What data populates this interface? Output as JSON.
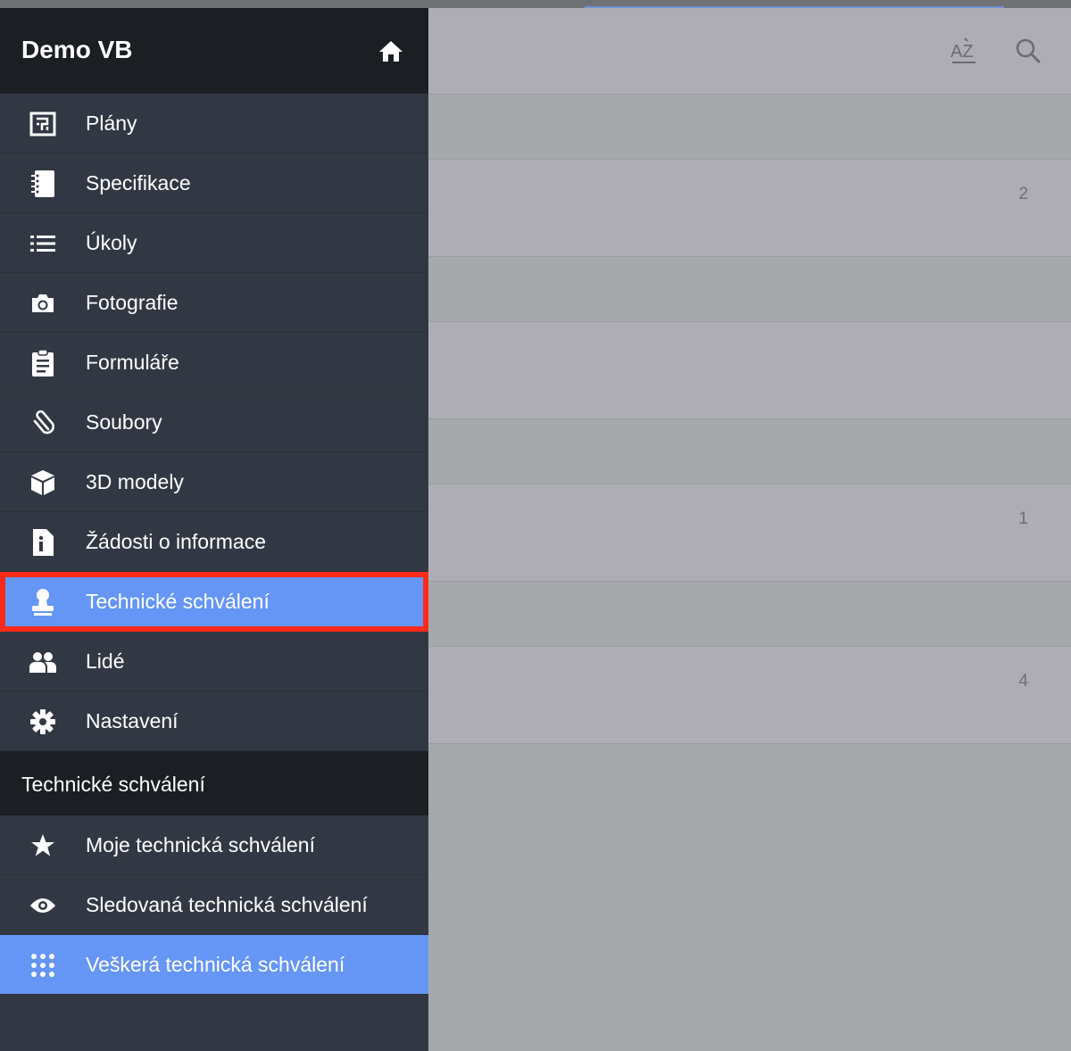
{
  "app": {
    "title": "Demo VB"
  },
  "nav": {
    "items": [
      {
        "label": "Plány",
        "icon": "floorplan-icon"
      },
      {
        "label": "Specifikace",
        "icon": "notebook-icon"
      },
      {
        "label": "Úkoly",
        "icon": "list-icon"
      },
      {
        "label": "Fotografie",
        "icon": "camera-icon"
      },
      {
        "label": "Formuláře",
        "icon": "clipboard-icon"
      },
      {
        "label": "Soubory",
        "icon": "paperclip-icon"
      },
      {
        "label": "3D modely",
        "icon": "cube-icon"
      },
      {
        "label": "Žádosti o informace",
        "icon": "info-document-icon"
      },
      {
        "label": "Technické schválení",
        "icon": "stamp-icon"
      },
      {
        "label": "Lidé",
        "icon": "people-icon"
      },
      {
        "label": "Nastavení",
        "icon": "gear-icon"
      }
    ],
    "selected": "Technické schválení"
  },
  "section": {
    "title": "Technické schválení",
    "items": [
      {
        "label": "Moje technická schválení",
        "icon": "star-icon"
      },
      {
        "label": "Sledovaná technická schválení",
        "icon": "eye-icon"
      },
      {
        "label": "Veškerá technická schválení",
        "icon": "grid-dots-icon"
      }
    ],
    "selected": "Veškerá technická schválení"
  },
  "toolbar": {
    "sort_icon": "sort-az-icon",
    "search_icon": "search-icon",
    "sort_glyph": "AZ"
  },
  "list": {
    "rows": [
      {
        "count": "2"
      },
      {
        "count": ""
      },
      {
        "count": "1"
      },
      {
        "count": "4"
      }
    ]
  },
  "colors": {
    "sidebar_bg": "#323843",
    "header_bg": "#1b1e23",
    "accent": "#6595f5",
    "highlight_border": "#ff2a1a",
    "overlay_bg": "#a4a8ab"
  }
}
